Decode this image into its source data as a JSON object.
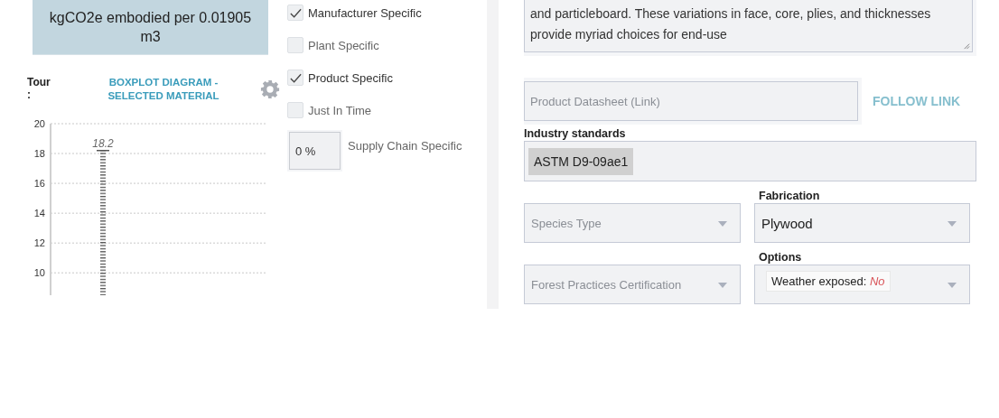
{
  "impact": {
    "unit_label": "kgCO2e embodied per 0.01905 m3"
  },
  "chart_panel": {
    "tour_label": "Tour\n:",
    "title": "BOXPLOT DIAGRAM -\nSELECTED MATERIAL",
    "chart_data": {
      "type": "bar",
      "ylim": [
        8.5,
        20
      ],
      "yticks": [
        10,
        12,
        14,
        16,
        18,
        20
      ],
      "values": [
        18.2
      ],
      "value_labels": [
        "18.2"
      ],
      "grid": true
    }
  },
  "specificity": [
    {
      "label": "Manufacturer Specific",
      "checked": true
    },
    {
      "label": "Plant Specific",
      "checked": false
    },
    {
      "label": "Product Specific",
      "checked": true
    },
    {
      "label": "Just In Time",
      "checked": false
    }
  ],
  "supply_chain": {
    "value": "0 %",
    "label": "Supply Chain Specific"
  },
  "description": {
    "value": "and particleboard. These variations in face, core, plies, and thicknesses provide myriad choices for end-use"
  },
  "datasheet": {
    "placeholder": "Product Datasheet (Link)",
    "link": "FOLLOW LINK",
    "disabled": true
  },
  "industry_standards": {
    "label": "Industry standards",
    "tags": [
      "ASTM D9-09ae1"
    ]
  },
  "selects": [
    {
      "placeholder": "Species Type"
    },
    {
      "label": "Fabrication",
      "value": "Plywood"
    },
    {
      "placeholder": "Forest Practices Certification"
    },
    {
      "label": "Options",
      "option_name": "Weather exposed:",
      "option_value": "No"
    }
  ]
}
